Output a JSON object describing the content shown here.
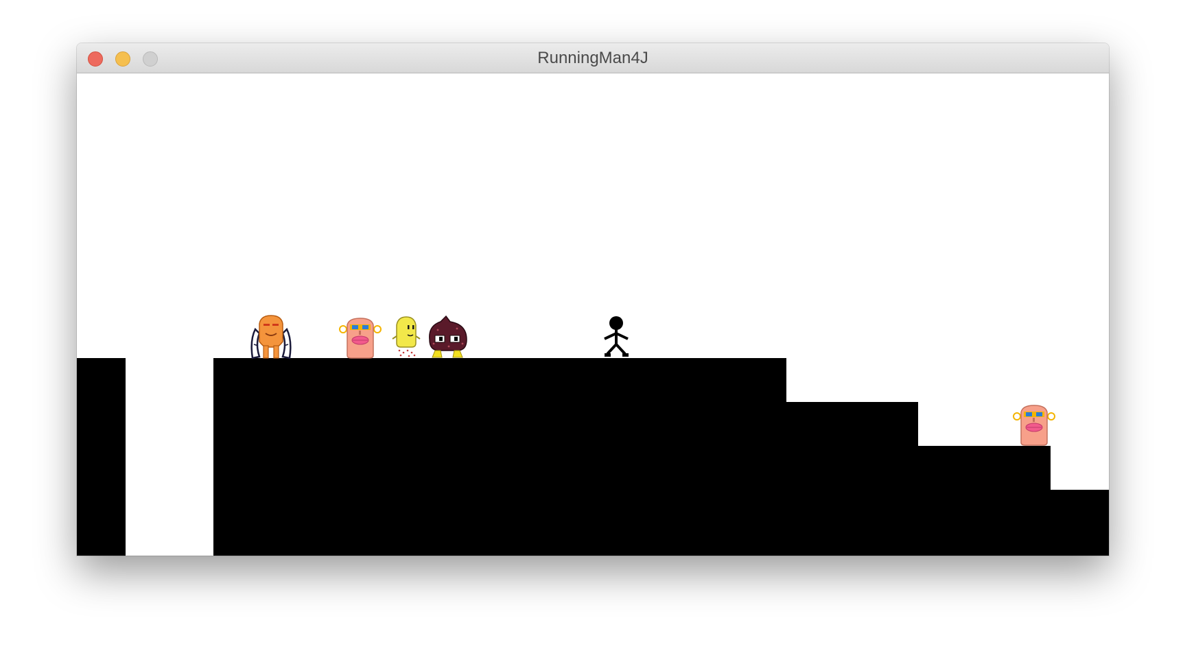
{
  "window": {
    "title": "RunningMan4J"
  },
  "colors": {
    "background": "#ffffff",
    "terrain": "#000000",
    "close": "#ed6a5e",
    "minimize": "#f5bf4f",
    "maximize": "#d0d0d0"
  },
  "sprites": [
    {
      "kind": "orange-winged-monster"
    },
    {
      "kind": "pink-goggle-monster"
    },
    {
      "kind": "yellow-ghost-monster"
    },
    {
      "kind": "dark-spotted-blob-monster"
    },
    {
      "kind": "stick-figure-player"
    },
    {
      "kind": "pink-goggle-monster"
    }
  ]
}
